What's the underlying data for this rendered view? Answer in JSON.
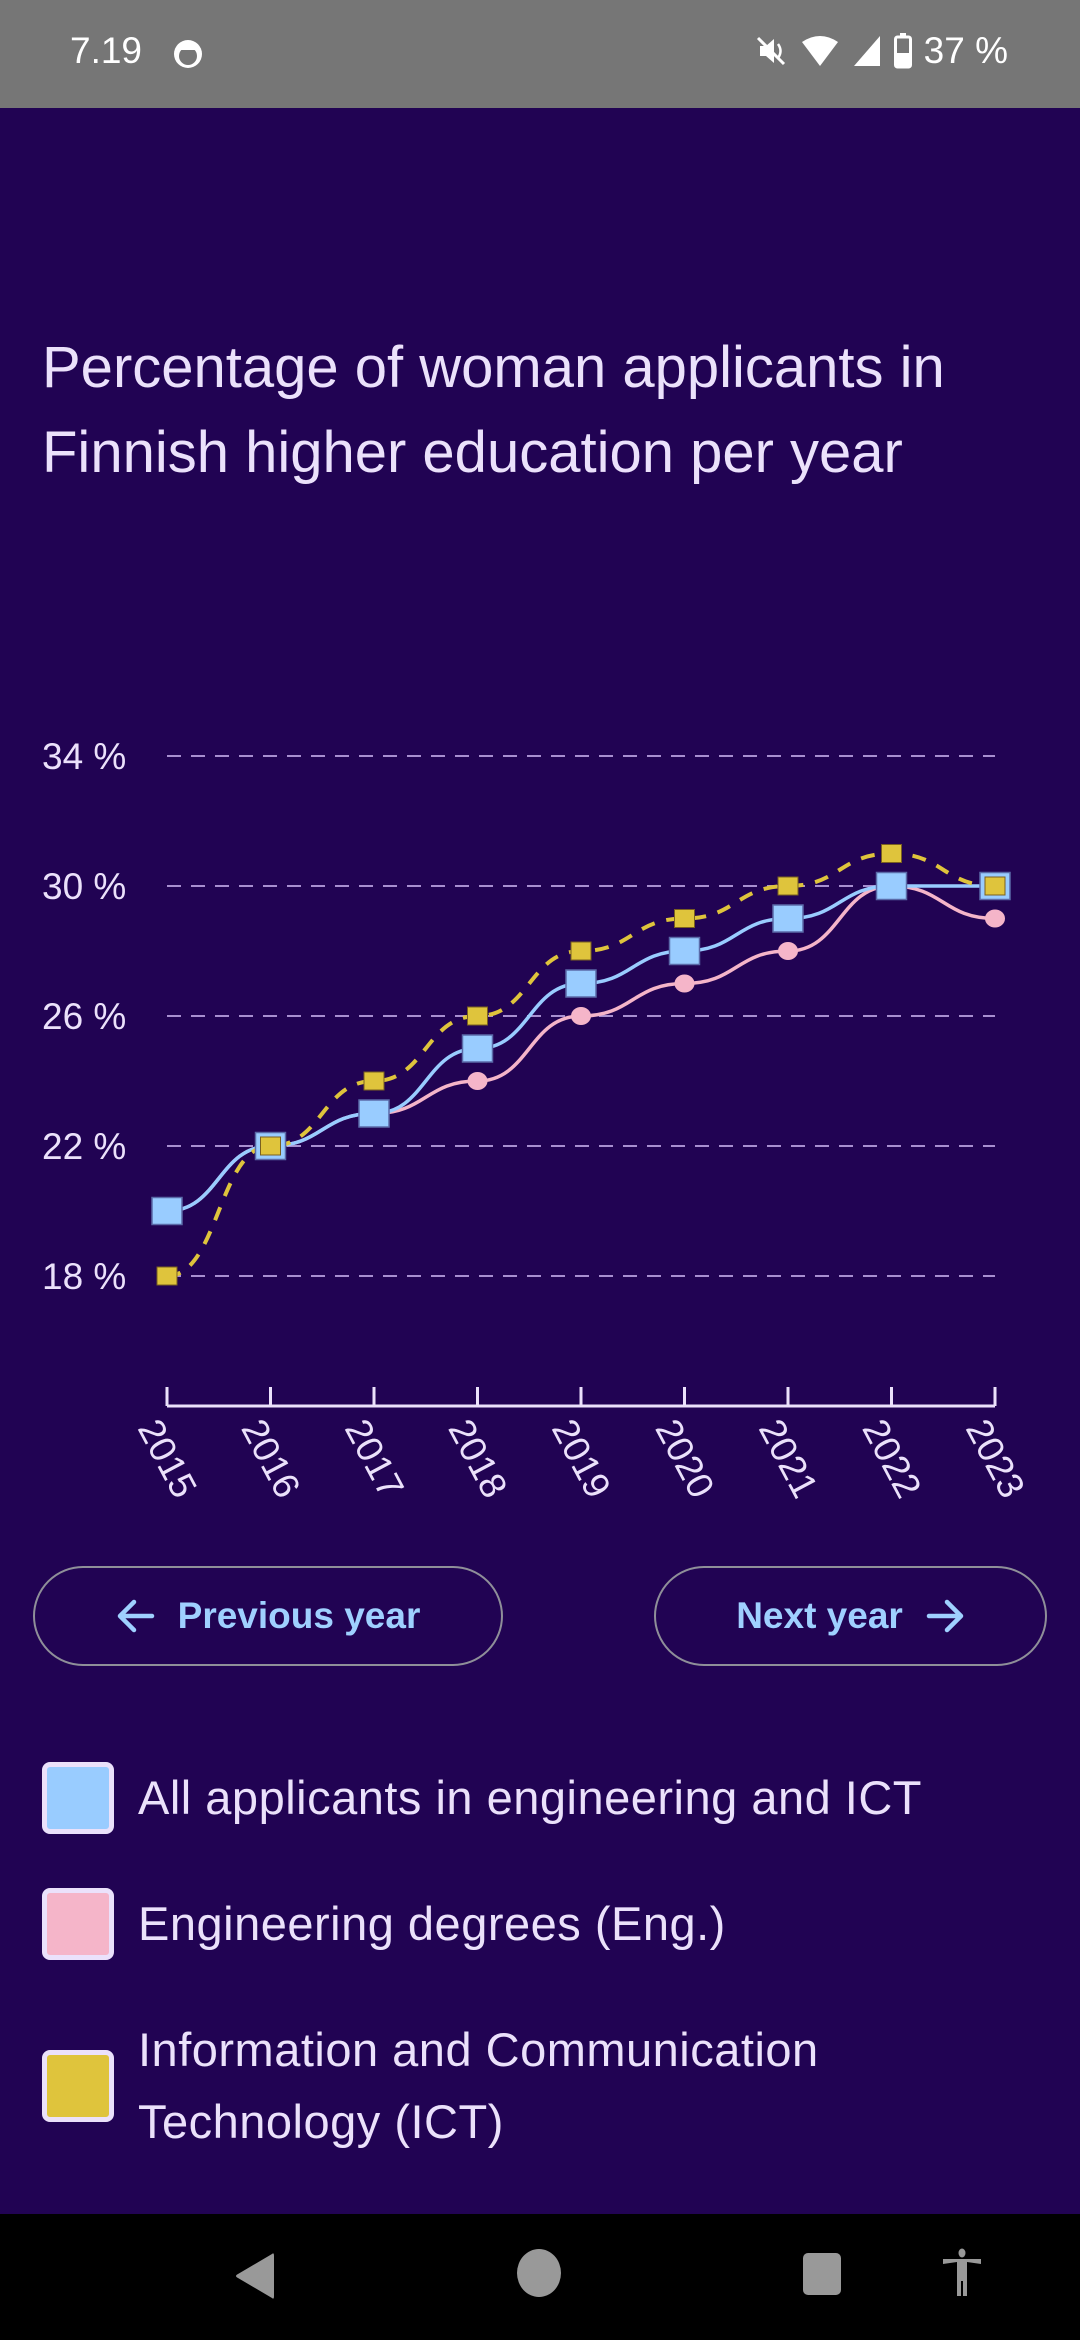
{
  "status_bar": {
    "time": "7.19",
    "battery_percent": "37 %",
    "icons": [
      "app-notification-icon",
      "mute-icon",
      "wifi-icon",
      "signal-icon",
      "battery-icon"
    ]
  },
  "page": {
    "title": "Percentage of woman applicants in Finnish higher education per year"
  },
  "buttons": {
    "previous_label": "Previous year",
    "next_label": "Next year"
  },
  "legend": [
    {
      "label": "All applicants in engineering and ICT",
      "color": "#99ccff"
    },
    {
      "label": "Engineering degrees (Eng.)",
      "color": "#f5b5c9"
    },
    {
      "label": "Information and Communication Technology (ICT)",
      "color": "#dfc43c"
    }
  ],
  "nav_bar": {
    "icons": [
      "back-icon",
      "home-icon",
      "recents-icon",
      "accessibility-icon"
    ]
  },
  "chart_data": {
    "type": "line",
    "title": "Percentage of woman applicants in Finnish higher education per year",
    "xlabel": "",
    "ylabel": "",
    "x": [
      "2015",
      "2016",
      "2017",
      "2018",
      "2019",
      "2020",
      "2021",
      "2022",
      "2023"
    ],
    "ylim": [
      18,
      34
    ],
    "yticks": [
      34,
      30,
      26,
      22,
      18
    ],
    "ytick_labels": [
      "34 %",
      "30 %",
      "26 %",
      "22 %",
      "18 %"
    ],
    "grid": "horizontal-dashed",
    "legend_position": "below",
    "series": [
      {
        "name": "Engineering degrees (Eng.)",
        "color": "#f5b5c9",
        "marker": "circle",
        "line": "solid",
        "values": [
          20,
          22,
          23,
          24,
          26,
          27,
          28,
          30,
          29
        ]
      },
      {
        "name": "All applicants in engineering and ICT",
        "color": "#99ccff",
        "marker": "square",
        "line": "solid",
        "values": [
          20,
          22,
          23,
          25,
          27,
          28,
          29,
          30,
          30
        ]
      },
      {
        "name": "Information and Communication Technology (ICT)",
        "color": "#dfc43c",
        "marker": "square-small",
        "line": "dashed",
        "values": [
          18,
          22,
          24,
          26,
          28,
          29,
          30,
          31,
          30
        ]
      }
    ]
  }
}
